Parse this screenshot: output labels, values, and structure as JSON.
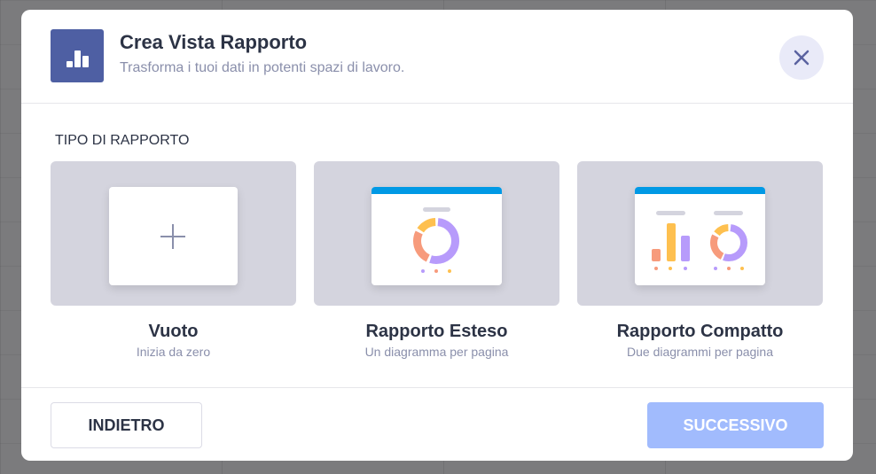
{
  "header": {
    "title": "Crea Vista Rapporto",
    "subtitle": "Trasforma i tuoi dati in potenti spazi di lavoro."
  },
  "section_label": "TIPO DI RAPPORTO",
  "options": [
    {
      "name": "Vuoto",
      "desc": "Inizia da zero"
    },
    {
      "name": "Rapporto Esteso",
      "desc": "Un diagramma per pagina"
    },
    {
      "name": "Rapporto Compatto",
      "desc": "Due diagrammi per pagina"
    }
  ],
  "footer": {
    "back_label": "INDIETRO",
    "next_label": "SUCCESSIVO"
  },
  "colors": {
    "accent": "#4e5fa3",
    "blue": "#0099e5",
    "purple": "#b79bfb",
    "orange": "#f79b7c",
    "yellow": "#fec04f",
    "next_disabled": "#a1bbfd"
  }
}
